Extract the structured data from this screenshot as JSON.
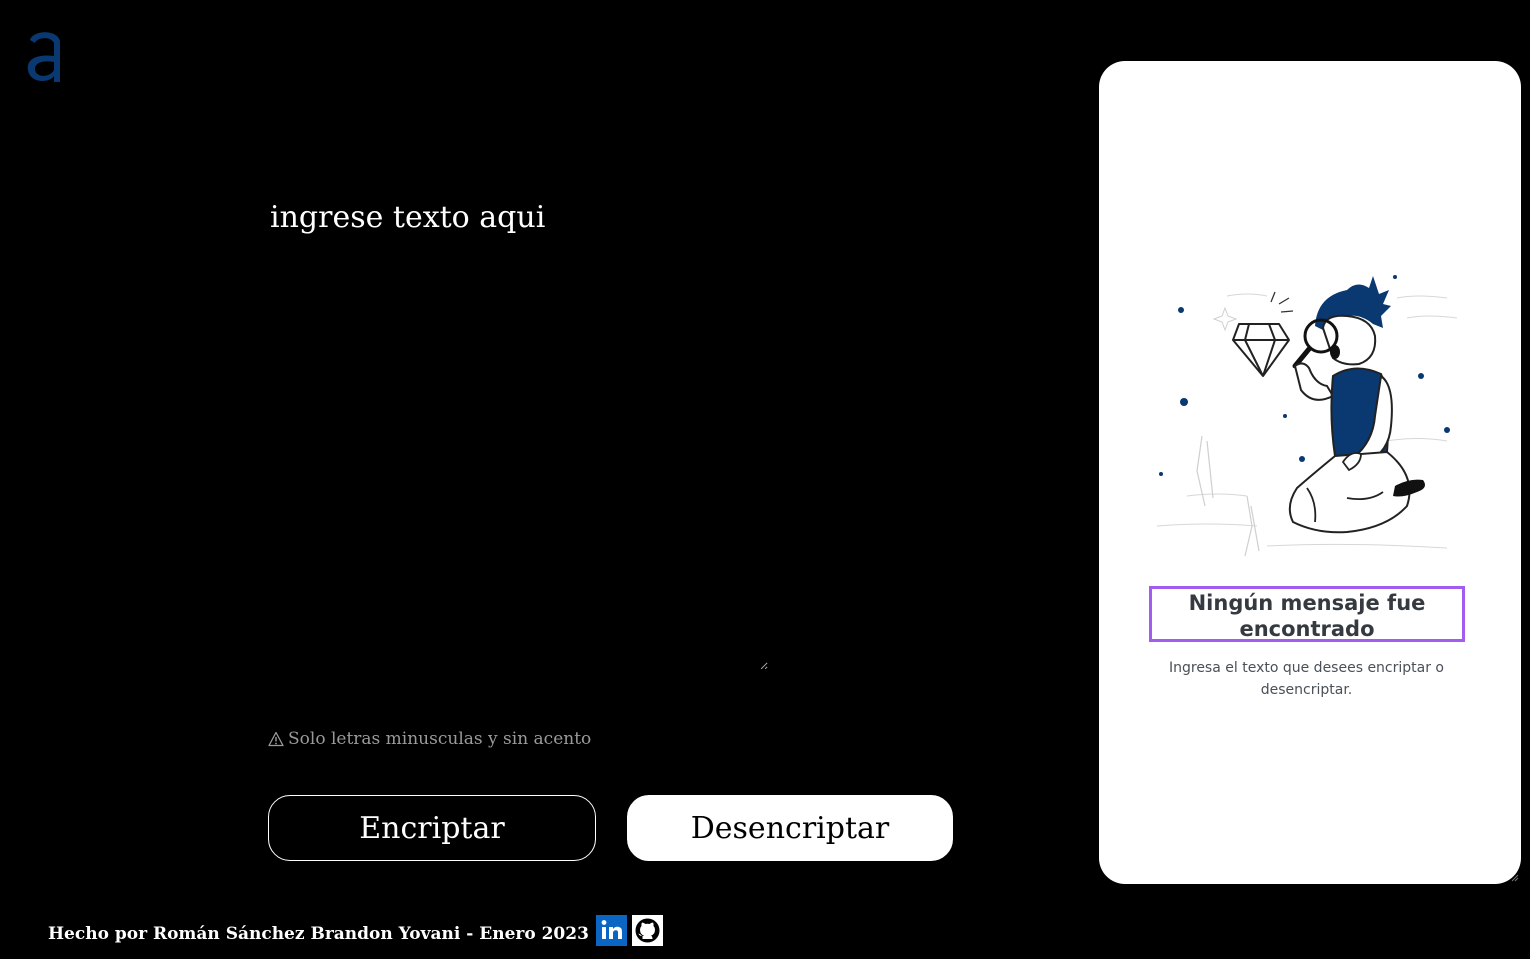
{
  "logo": {
    "icon": "alura-a-logo-icon",
    "color": "#0a3871"
  },
  "input": {
    "placeholder": "ingrese texto aqui",
    "value": ""
  },
  "warning": {
    "icon": "warning-triangle-icon",
    "text": "Solo letras minusculas y sin acento"
  },
  "buttons": {
    "encrypt_label": "Encriptar",
    "decrypt_label": "Desencriptar"
  },
  "output_panel": {
    "illustration": "person-with-magnifier-illustration",
    "title": "Ningún mensaje fue encontrado",
    "text": "Ingresa el texto que desees encriptar o desencriptar.",
    "title_border_color": "#a15cf0"
  },
  "footer": {
    "text": "Hecho por Román Sánchez Brandon Yovani - Enero 2023",
    "links": [
      {
        "icon": "linkedin-icon",
        "color": "#0a66c2"
      },
      {
        "icon": "github-icon",
        "color": "#000000"
      }
    ]
  }
}
